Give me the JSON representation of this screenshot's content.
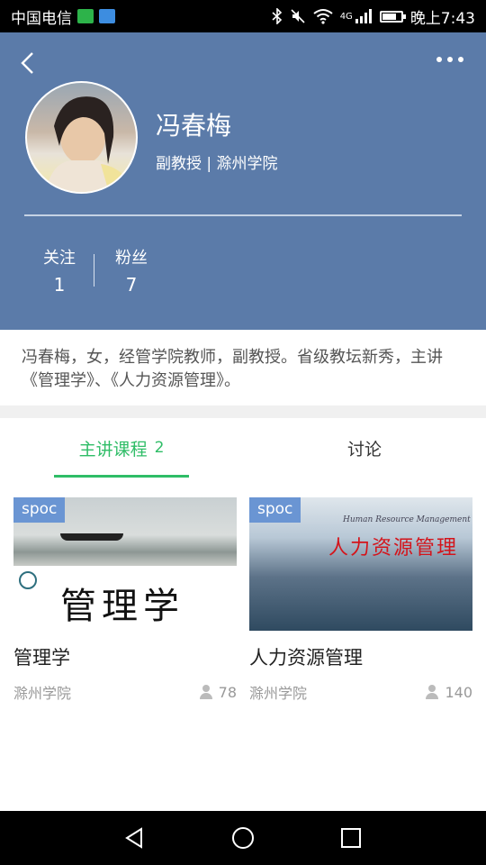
{
  "status_bar": {
    "carrier": "中国电信",
    "time": "晚上7:43",
    "network": "4G",
    "icons": [
      "bluetooth-icon",
      "mute-icon",
      "wifi-icon",
      "signal-icon",
      "battery-icon"
    ],
    "battery_level": 0.7
  },
  "header": {
    "back_icon": "chevron-left-icon",
    "more_icon": "more-dots-icon",
    "background_color": "#5b7ba9"
  },
  "profile": {
    "name": "冯春梅",
    "title": "副教授 | 滁州学院",
    "stats": [
      {
        "label": "关注",
        "value": "1"
      },
      {
        "label": "粉丝",
        "value": "7"
      }
    ],
    "bio": "冯春梅，女，经管学院教师，副教授。省级教坛新秀，主讲《管理学》、《人力资源管理》。"
  },
  "tabs": [
    {
      "label": "主讲课程",
      "count": "2",
      "active": true
    },
    {
      "label": "讨论",
      "active": false
    }
  ],
  "accent_color": "#2fbd67",
  "courses": [
    {
      "badge": "spoc",
      "name": "管理学",
      "school": "滁州学院",
      "learners": "78",
      "cover_text": "管理学"
    },
    {
      "badge": "spoc",
      "name": "人力资源管理",
      "school": "滁州学院",
      "learners": "140",
      "cover_text": "人力资源管理",
      "cover_subtitle": "Human Resource Management"
    }
  ],
  "nav": {
    "icons": [
      "back-triangle-icon",
      "home-circle-icon",
      "recents-square-icon"
    ]
  }
}
